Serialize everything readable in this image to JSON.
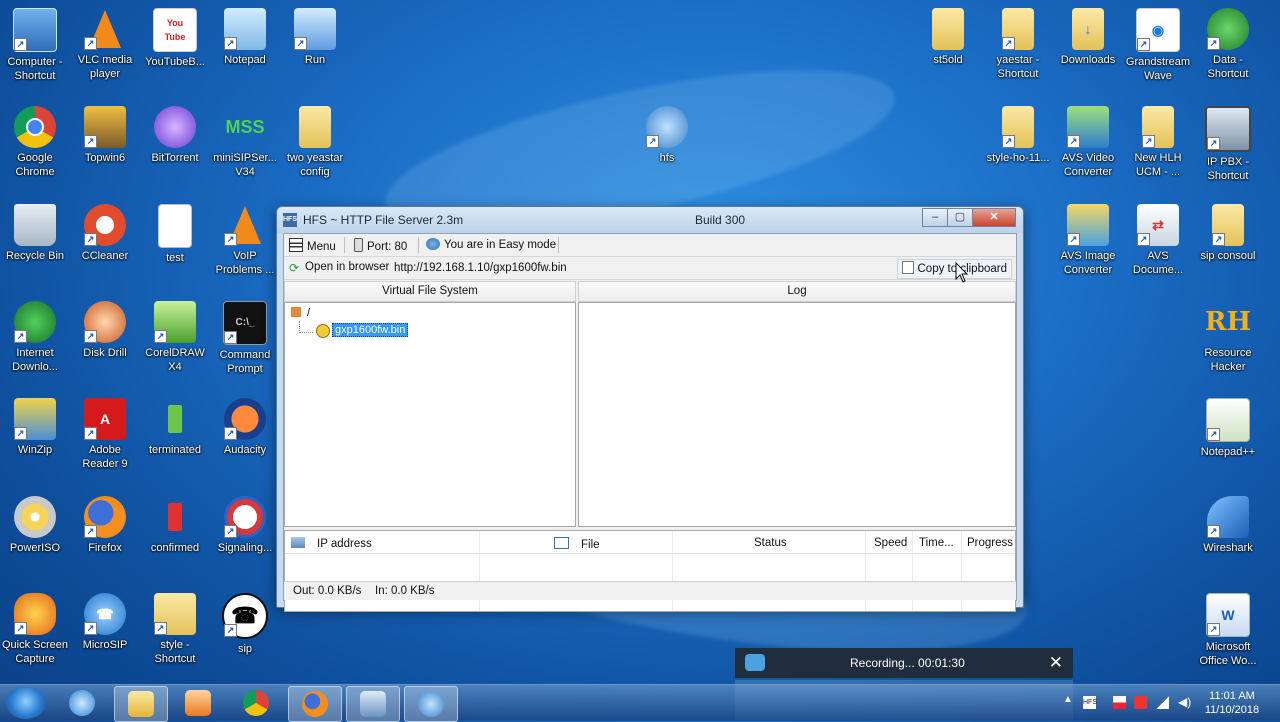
{
  "desktop_icons": {
    "computer": "Computer - Shortcut",
    "vlc": "VLC media player",
    "youtube": "YouTubeB...",
    "notepad": "Notepad",
    "run": "Run",
    "st5old": "st5old",
    "yaestar": "yaestar - Shortcut",
    "downloads": "Downloads",
    "grandstream": "Grandstream Wave",
    "data": "Data - Shortcut",
    "chrome": "Google Chrome",
    "topwin": "Topwin6",
    "bittorrent": "BitTorrent",
    "minisip": "miniSIPSer... V34",
    "twoyeastar": "two yeastar config",
    "hfs": "hfs",
    "stylehol": "style-ho-11...",
    "avsvideo": "AVS Video Converter",
    "newhlh": "New HLH UCM - ...",
    "ippbx": "IP PBX - Shortcut",
    "recycle": "Recycle Bin",
    "ccleaner": "CCleaner",
    "test": "test",
    "voip": "VoIP Problems ...",
    "avsimage": "AVS Image Converter",
    "avsdoc": "AVS Docume...",
    "sipconsoul": "sip consoul",
    "idm": "Internet Downlo...",
    "diskdrill": "Disk Drill",
    "corel": "CorelDRAW X4",
    "cmd": "Command Prompt",
    "reshacker": "Resource Hacker",
    "winzip": "WinZip",
    "adobe": "Adobe Reader 9",
    "terminated": "terminated",
    "audacity": "Audacity",
    "notepadpp": "Notepad++",
    "poweriso": "PowerISO",
    "firefox": "Firefox",
    "confirmed": "confirmed",
    "signaling": "Signaling...",
    "wireshark": "Wireshark",
    "quickscreen": "Quick Screen Capture",
    "microsip": "MicroSIP",
    "style": "style - Shortcut",
    "sip": "sip",
    "word": "Microsoft Office Wo..."
  },
  "hfs_window": {
    "title": "HFS ~ HTTP File Server 2.3m",
    "build": "Build 300",
    "app_icon_text": "HFS",
    "minimize": "–",
    "maximize": "▢",
    "close": "✕",
    "menu_label": "Menu",
    "port_label": "Port: 80",
    "mode_label": "You are in Easy mode",
    "open_browser_label": "Open in browser",
    "url": "http://192.168.1.10/gxp1600fw.bin",
    "copy_label": "Copy to clipboard",
    "vfs_header": "Virtual File System",
    "log_header": "Log",
    "tree_root": "/",
    "tree_item": "gxp1600fw.bin",
    "columns": {
      "ip": "IP address",
      "file": "File",
      "status": "Status",
      "speed": "Speed",
      "time": "Time...",
      "progress": "Progress"
    },
    "out_speed": "Out: 0.0 KB/s",
    "in_speed": "In: 0.0 KB/s"
  },
  "recording": {
    "text": "Recording... 00:01:30",
    "close": "✕"
  },
  "taskbar": {
    "time": "11:01 AM",
    "date": "11/10/2018"
  },
  "colors": {
    "desktop": "#1a6cc4",
    "selection": "#3399ff",
    "recording_bg": "#1f2d3c"
  }
}
